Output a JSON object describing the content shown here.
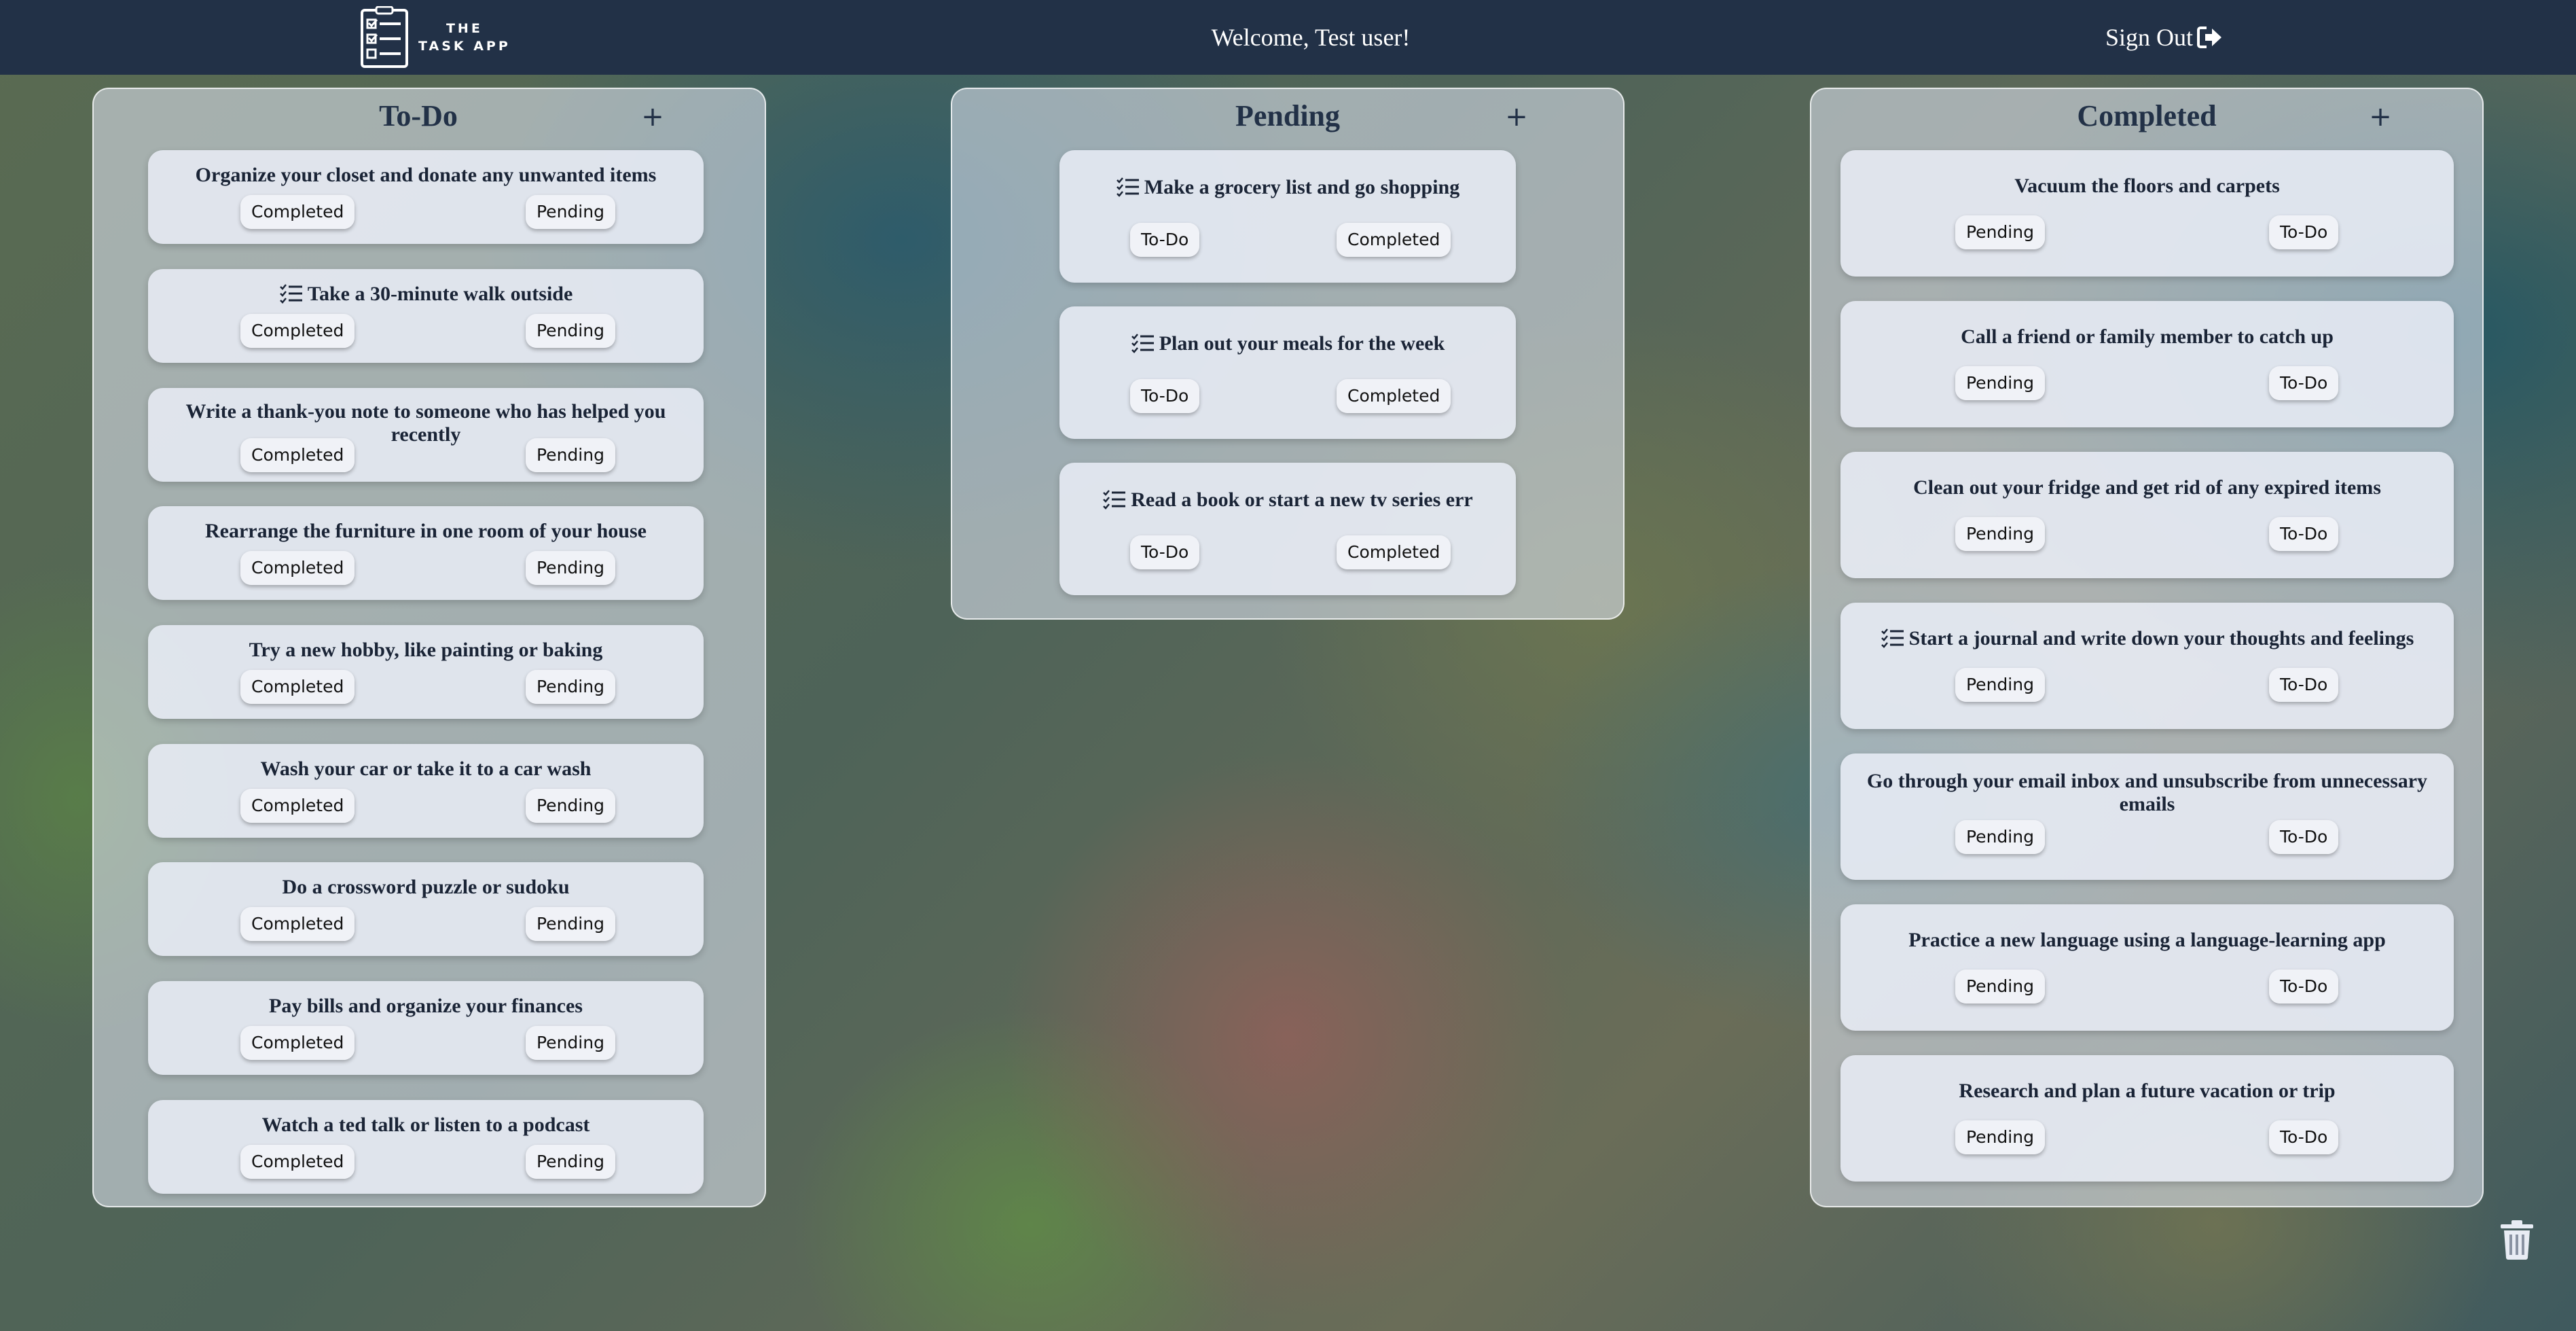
{
  "navbar": {
    "brand_line1": "THE",
    "brand_line2": "TASK APP",
    "logo_icon": "checklist-clipboard-icon",
    "welcome": "Welcome, Test user!",
    "signout_label": "Sign Out",
    "signout_icon": "sign-out-arrow-icon"
  },
  "columns": {
    "todo": {
      "title": "To-Do",
      "add_label": "+",
      "cards": [
        {
          "title": "Organize your closet and donate any unwanted items",
          "btn_a": "Completed",
          "btn_b": "Pending"
        },
        {
          "title": "Take a 30-minute walk outside",
          "btn_a": "Completed",
          "btn_b": "Pending"
        },
        {
          "title": "Write a thank-you note to someone who has helped you recently",
          "btn_a": "Completed",
          "btn_b": "Pending"
        },
        {
          "title": "Rearrange the furniture in one room of your house",
          "btn_a": "Completed",
          "btn_b": "Pending"
        },
        {
          "title": "Try a new hobby, like painting or baking",
          "btn_a": "Completed",
          "btn_b": "Pending"
        },
        {
          "title": "Wash your car or take it to a car wash",
          "btn_a": "Completed",
          "btn_b": "Pending"
        },
        {
          "title": "Do a crossword puzzle or sudoku",
          "btn_a": "Completed",
          "btn_b": "Pending"
        },
        {
          "title": "Pay bills and organize your finances",
          "btn_a": "Completed",
          "btn_b": "Pending"
        },
        {
          "title": "Watch a ted talk or listen to a podcast",
          "btn_a": "Completed",
          "btn_b": "Pending"
        }
      ]
    },
    "pending": {
      "title": "Pending",
      "add_label": "+",
      "cards": [
        {
          "title": "Make a grocery list and go shopping",
          "btn_a": "To-Do",
          "btn_b": "Completed"
        },
        {
          "title": "Plan out your meals for the week",
          "btn_a": "To-Do",
          "btn_b": "Completed"
        },
        {
          "title": "Read a book or start a new tv series err",
          "btn_a": "To-Do",
          "btn_b": "Completed"
        }
      ]
    },
    "completed": {
      "title": "Completed",
      "add_label": "+",
      "cards": [
        {
          "title": "Vacuum the floors and carpets",
          "btn_a": "Pending",
          "btn_b": "To-Do"
        },
        {
          "title": "Call a friend or family member to catch up",
          "btn_a": "Pending",
          "btn_b": "To-Do"
        },
        {
          "title": "Clean out your fridge and get rid of any expired items",
          "btn_a": "Pending",
          "btn_b": "To-Do"
        },
        {
          "title": "Start a journal and write down your thoughts and feelings",
          "btn_a": "Pending",
          "btn_b": "To-Do"
        },
        {
          "title": "Go through your email inbox and unsubscribe from unnecessary emails",
          "btn_a": "Pending",
          "btn_b": "To-Do"
        },
        {
          "title": "Practice a new language using a language-learning app",
          "btn_a": "Pending",
          "btn_b": "To-Do"
        },
        {
          "title": "Research and plan a future vacation or trip",
          "btn_a": "Pending",
          "btn_b": "To-Do"
        }
      ]
    }
  },
  "trash_icon": "trash-can-icon",
  "colors": {
    "navbar": "#223147",
    "column_title": "#223147",
    "card_text": "#1a2436"
  }
}
